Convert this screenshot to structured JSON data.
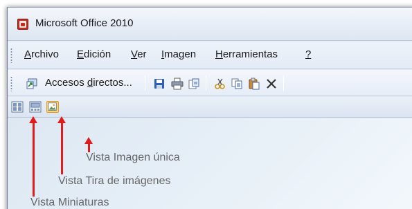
{
  "window": {
    "title": "Microsoft Office 2010"
  },
  "menu": {
    "items": [
      {
        "mnemonic": "A",
        "rest": "rchivo"
      },
      {
        "mnemonic": "E",
        "rest": "dición"
      },
      {
        "mnemonic": "V",
        "rest": "er"
      },
      {
        "mnemonic": "I",
        "rest": "magen"
      },
      {
        "mnemonic": "H",
        "rest": "erramientas"
      },
      {
        "mnemonic": "?",
        "rest": ""
      }
    ]
  },
  "toolbar": {
    "shortcuts_before": "Accesos ",
    "shortcuts_mnemonic": "d",
    "shortcuts_after": "irectos...",
    "icons": [
      "shortcuts-icon",
      "save-icon",
      "print-icon",
      "send-icon",
      "cut-icon",
      "copy-icon",
      "paste-icon",
      "delete-icon"
    ]
  },
  "views": {
    "buttons": [
      {
        "name": "thumbnails-view",
        "label": "Vista Miniaturas",
        "active": false
      },
      {
        "name": "filmstrip-view",
        "label": "Vista Tira de imágenes",
        "active": false
      },
      {
        "name": "single-image-view",
        "label": "Vista Imagen única",
        "active": true
      }
    ]
  },
  "colors": {
    "arrow": "#e01b1b",
    "active_button": "#fbd46f",
    "annotation_text": "#666666"
  }
}
